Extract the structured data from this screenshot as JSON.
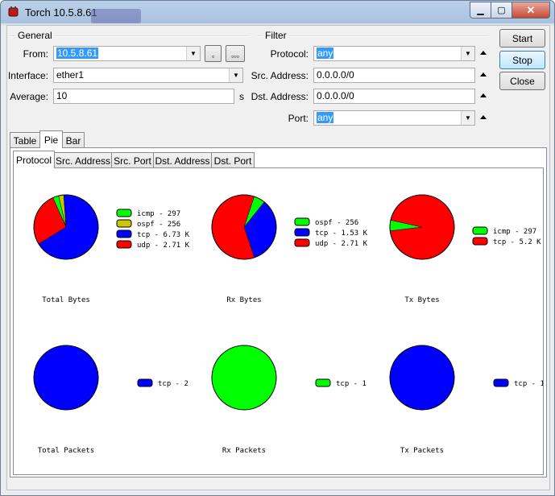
{
  "window": {
    "title": "Torch 10.5.8.61"
  },
  "general": {
    "title": "General",
    "from_label": "From:",
    "from_value": "10.5.8.61",
    "interface_label": "Interface:",
    "interface_value": "ether1",
    "average_label": "Average:",
    "average_value": "10",
    "average_unit": "s"
  },
  "filter": {
    "title": "Filter",
    "protocol_label": "Protocol:",
    "protocol_value": "any",
    "src_label": "Src. Address:",
    "src_value": "0.0.0.0/0",
    "dst_label": "Dst. Address:",
    "dst_value": "0.0.0.0/0",
    "port_label": "Port:",
    "port_value": "any"
  },
  "buttons": {
    "start": "Start",
    "stop": "Stop",
    "close": "Close"
  },
  "view_tabs": [
    "Table",
    "Pie",
    "Bar"
  ],
  "sub_tabs": [
    "Protocol",
    "Src. Address",
    "Src. Port",
    "Dst. Address",
    "Dst. Port"
  ],
  "colors": {
    "icmp": "#00ff00",
    "ospf": "#c8c800",
    "tcp": "#0000ff",
    "udp": "#ff0000"
  },
  "chart_data": [
    {
      "type": "pie",
      "title": "Total Bytes",
      "legend": [
        "icmp - 297",
        "ospf - 256",
        "tcp - 6.73 K",
        "udp - 2.71 K"
      ],
      "series": [
        {
          "name": "icmp",
          "value": 297,
          "color": "#00ff00"
        },
        {
          "name": "ospf",
          "value": 256,
          "color": "#c8c800"
        },
        {
          "name": "tcp",
          "value": 6730,
          "color": "#0000ff"
        },
        {
          "name": "udp",
          "value": 2710,
          "color": "#ff0000"
        }
      ]
    },
    {
      "type": "pie",
      "title": "Rx Bytes",
      "legend": [
        "ospf - 256",
        "tcp - 1.53 K",
        "udp - 2.71 K"
      ],
      "series": [
        {
          "name": "ospf",
          "value": 256,
          "color": "#00ff00"
        },
        {
          "name": "tcp",
          "value": 1530,
          "color": "#0000ff"
        },
        {
          "name": "udp",
          "value": 2710,
          "color": "#ff0000"
        }
      ]
    },
    {
      "type": "pie",
      "title": "Tx Bytes",
      "legend": [
        "icmp - 297",
        "tcp - 5.2 K"
      ],
      "series": [
        {
          "name": "icmp",
          "value": 297,
          "color": "#00ff00"
        },
        {
          "name": "tcp",
          "value": 5200,
          "color": "#ff0000"
        }
      ]
    },
    {
      "type": "pie",
      "title": "Total Packets",
      "legend": [
        "tcp - 2"
      ],
      "series": [
        {
          "name": "tcp",
          "value": 2,
          "color": "#0000ff"
        }
      ]
    },
    {
      "type": "pie",
      "title": "Rx Packets",
      "legend": [
        "tcp - 1"
      ],
      "series": [
        {
          "name": "tcp",
          "value": 1,
          "color": "#00ff00"
        }
      ]
    },
    {
      "type": "pie",
      "title": "Tx Packets",
      "legend": [
        "tcp - 1"
      ],
      "series": [
        {
          "name": "tcp",
          "value": 1,
          "color": "#0000ff"
        }
      ]
    }
  ]
}
